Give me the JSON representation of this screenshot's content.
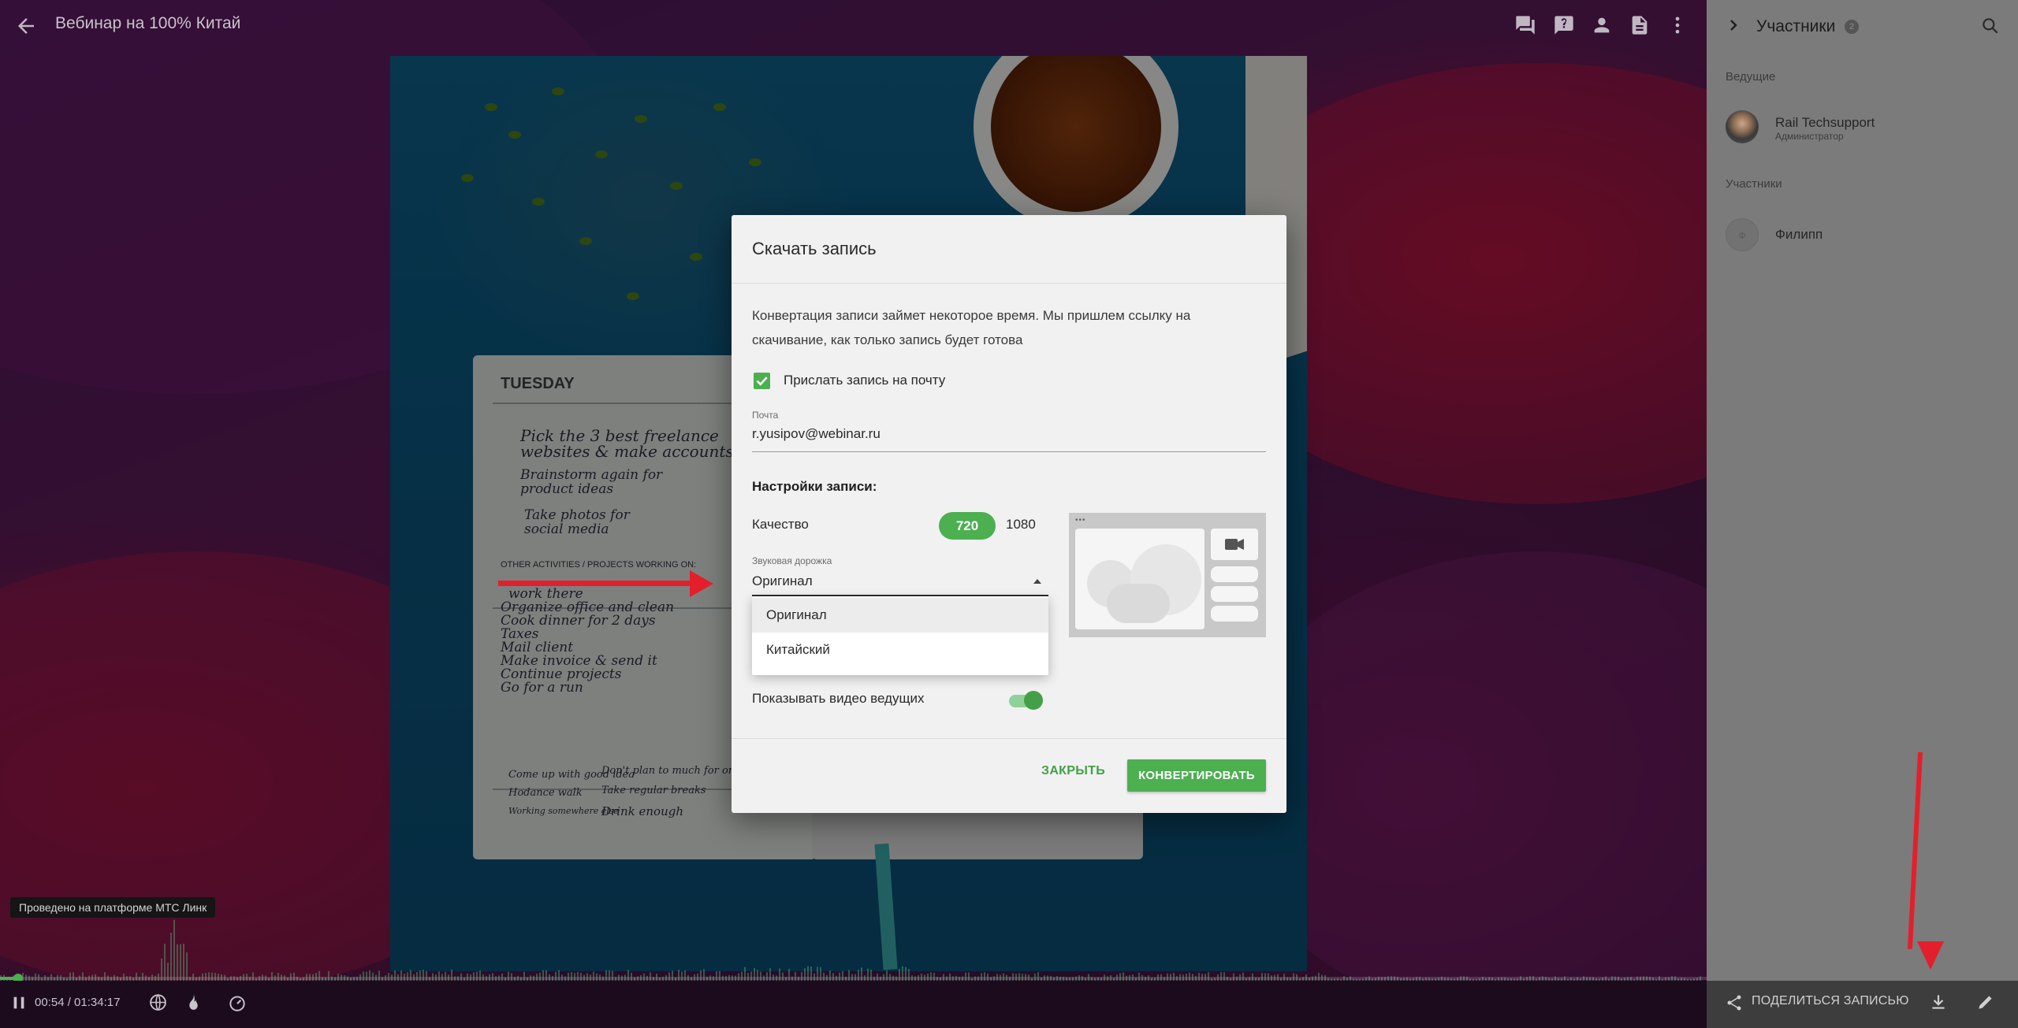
{
  "window": {
    "title": "Вебинар на 100% Китай"
  },
  "photo_notebook": {
    "title": "TUESDAY",
    "lines": [
      "Pick the 3 best freelance",
      "websites & make accounts",
      "Brainstorm again for",
      "product ideas",
      "Take photos for",
      "social media",
      "OTHER ACTIVITIES / PROJECTS WORKING ON:",
      "work there",
      "Organize office and clean",
      "Cook dinner for 2 days",
      "Taxes",
      "Mail client",
      "Make invoice & send it",
      "Continue projects",
      "Go for a run",
      "Come up with good idea",
      "Don't plan to much for one day",
      "Take regular breaks",
      "Drink enough",
      "Hodance walk",
      "Working somewhere else"
    ]
  },
  "sidebar": {
    "title": "Участники",
    "count": "2",
    "hosts_heading": "Ведущие",
    "host": {
      "name": "Rail Techsupport",
      "role": "Администратор"
    },
    "participants_heading": "Участники",
    "participant": {
      "initial": "Ф",
      "name": "Филипп"
    }
  },
  "player": {
    "time": "00:54 / 01:34:17",
    "progress_fraction": 0.0095,
    "platform_badge": "Проведено на платформе МТС Линк",
    "share_label": "ПОДЕЛИТЬСЯ ЗАПИСЬЮ"
  },
  "dialog": {
    "title": "Скачать запись",
    "description": "Конвертация записи займет некоторое время. Мы пришлем ссылку на скачивание, как только запись будет готова",
    "email_checkbox_label": "Прислать запись на почту",
    "email_checked": true,
    "email_field_label": "Почта",
    "email_value": "r.yusipov@webinar.ru",
    "settings_heading": "Настройки записи:",
    "quality_label": "Качество",
    "quality_options": [
      "720",
      "1080"
    ],
    "quality_selected": "720",
    "audio_label": "Звуковая дорожка",
    "audio_value": "Оригинал",
    "audio_options": [
      "Оригинал",
      "Китайский"
    ],
    "show_video_label": "Показывать видео ведущих",
    "show_video_on": true,
    "close_label": "ЗАКРЫТЬ",
    "convert_label": "КОНВЕРТИРОВАТЬ"
  },
  "colors": {
    "accent": "#4caf50",
    "annotation_red": "#e31f2c"
  },
  "icons": {
    "back": "arrow-left-icon",
    "chat": "chat-icon",
    "questions": "question-icon",
    "participants": "person-icon",
    "files": "file-icon",
    "more": "more-vertical-icon",
    "search": "search-icon",
    "pause": "pause-icon",
    "share": "share-icon",
    "download": "download-icon",
    "edit": "pencil-icon"
  }
}
